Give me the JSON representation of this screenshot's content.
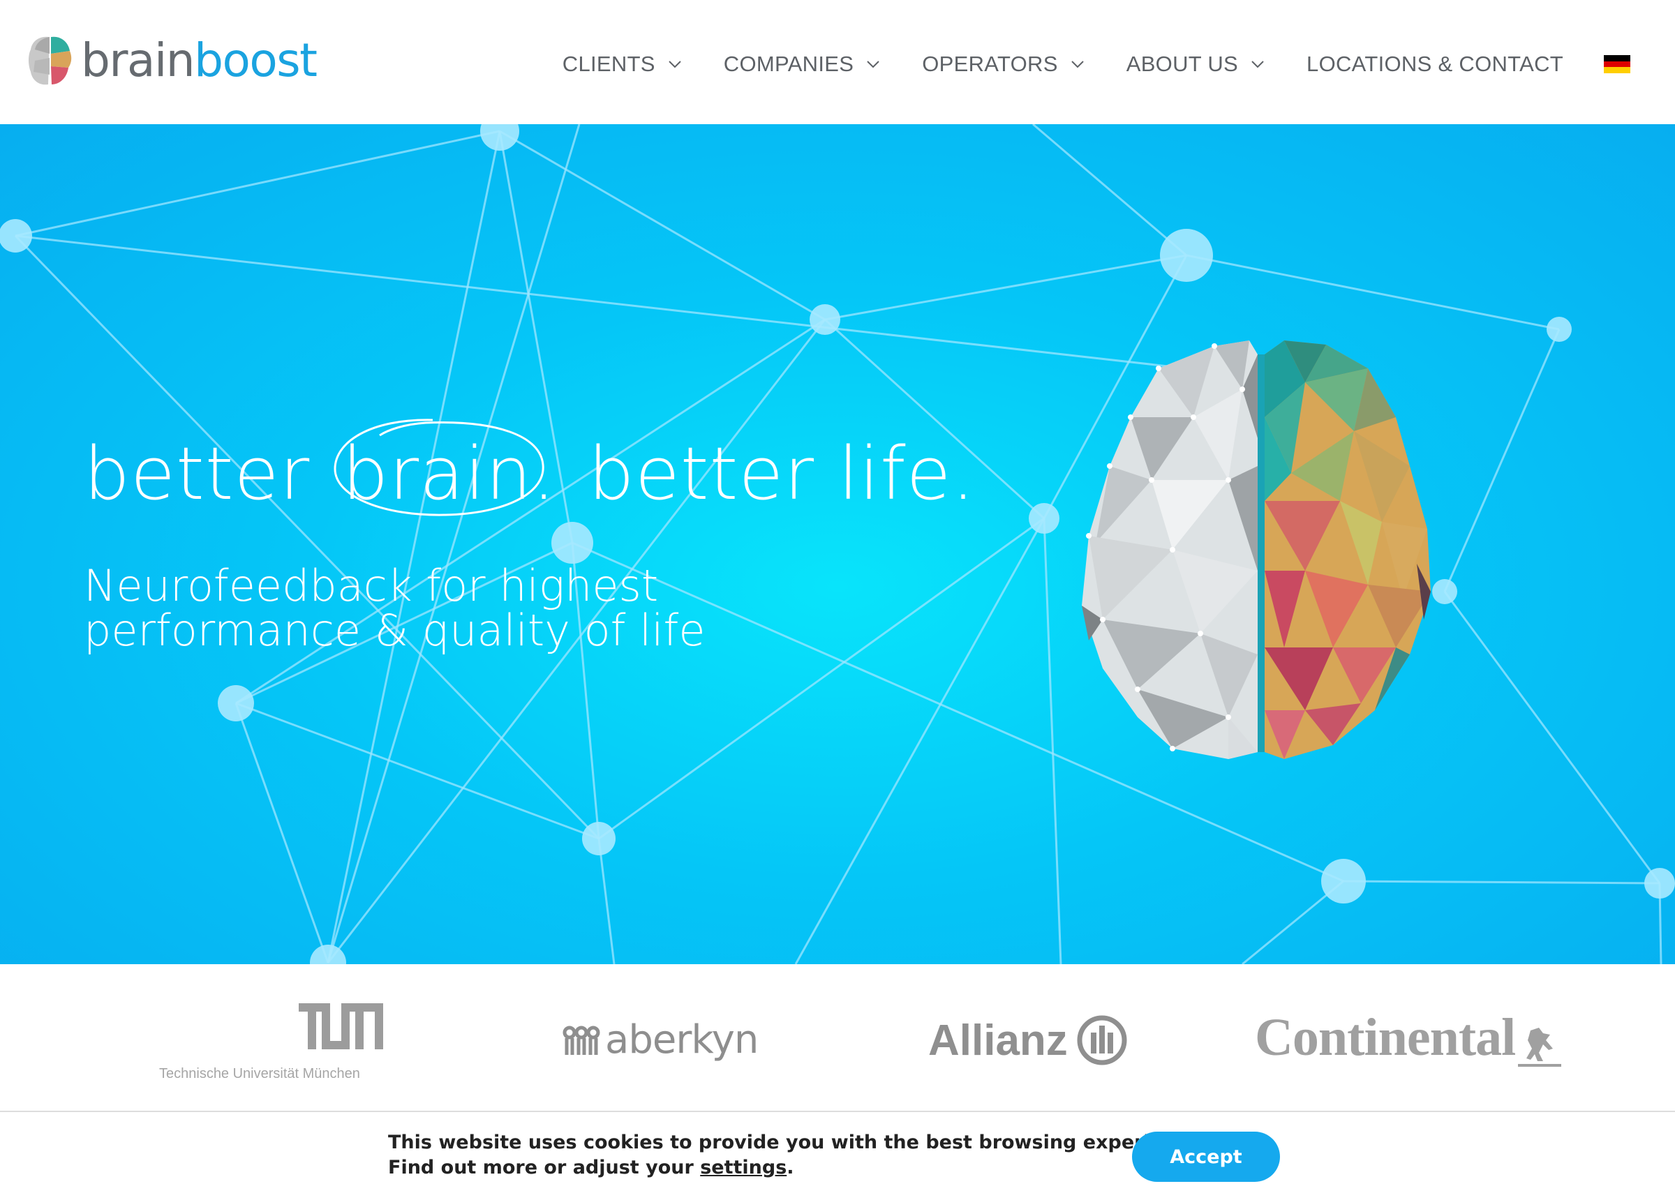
{
  "header": {
    "logo": {
      "word1": "brain",
      "word2": "boost"
    },
    "nav": [
      {
        "label": "CLIENTS",
        "has_dropdown": true
      },
      {
        "label": "COMPANIES",
        "has_dropdown": true
      },
      {
        "label": "OPERATORS",
        "has_dropdown": true
      },
      {
        "label": "ABOUT US",
        "has_dropdown": true
      },
      {
        "label": "LOCATIONS & CONTACT",
        "has_dropdown": false
      }
    ],
    "language_flag": {
      "icon": "german-flag-icon",
      "colors": [
        "#000000",
        "#dd0000",
        "#ffce00"
      ]
    }
  },
  "hero": {
    "title_pre": "better",
    "title_circled": "brain.",
    "title_post": "better life.",
    "subtitle_line1": "Neurofeedback for highest",
    "subtitle_line2": "performance & quality of life",
    "background_color": "#05c6f7"
  },
  "partners": {
    "tum": {
      "mark": "TUM",
      "caption": "Technische Universität München"
    },
    "aberkyn": {
      "name": "aberkyn"
    },
    "allianz": {
      "name": "Allianz"
    },
    "continental": {
      "name": "Continental"
    }
  },
  "cookie": {
    "line1": "This website uses cookies to provide you with the best browsing experience.",
    "line2_pre": "Find out more or adjust your ",
    "line2_link": "settings",
    "line2_post": ".",
    "accept_label": "Accept",
    "accent": "#15a9ee"
  }
}
